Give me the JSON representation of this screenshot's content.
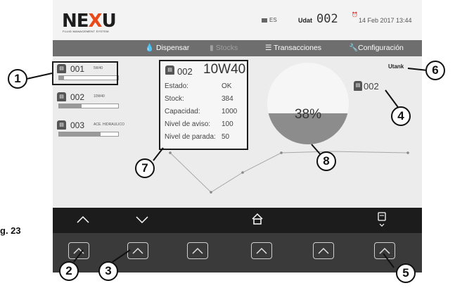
{
  "header": {
    "logo_main_1": "NE",
    "logo_x": "X",
    "logo_main_2": "U",
    "logo_sub": "FLUID MANAGEMENT SYSTEM",
    "lang": "ES",
    "udat_label": "Udat",
    "udat_value": "002",
    "datetime": "14 Feb 2017 13:44"
  },
  "nav": {
    "dispensar": "Dispensar",
    "stocks": "Stocks",
    "transacciones": "Transacciones",
    "configuracion": "Configuración"
  },
  "tanks": [
    {
      "id": "001",
      "product": "5W40",
      "level": 0.08
    },
    {
      "id": "002",
      "product": "10W40",
      "level": 0.38
    },
    {
      "id": "003",
      "product": "ACE. HIDRAULICO",
      "level": 0.7
    }
  ],
  "info": {
    "id": "002",
    "product": "10W40",
    "rows": [
      {
        "label": "Estado:",
        "value": "OK"
      },
      {
        "label": "Stock:",
        "value": "384"
      },
      {
        "label": "Capacidad:",
        "value": "1000"
      },
      {
        "label": "Nivel de aviso:",
        "value": "100"
      },
      {
        "label": "Nivel de parada:",
        "value": "50"
      }
    ]
  },
  "utank": "Utank",
  "right_id": "002",
  "gauge": {
    "percent_label": "38%",
    "fill": 0.38
  },
  "figure_label": "g. 23",
  "callouts": [
    "1",
    "2",
    "3",
    "4",
    "5",
    "6",
    "7",
    "8"
  ],
  "colors": {
    "accent_orange": "#e84a1a",
    "nav_bg": "#6e6e6e",
    "gauge_fill": "#8c8c8c",
    "dark_bar": "#1c1c1c"
  }
}
